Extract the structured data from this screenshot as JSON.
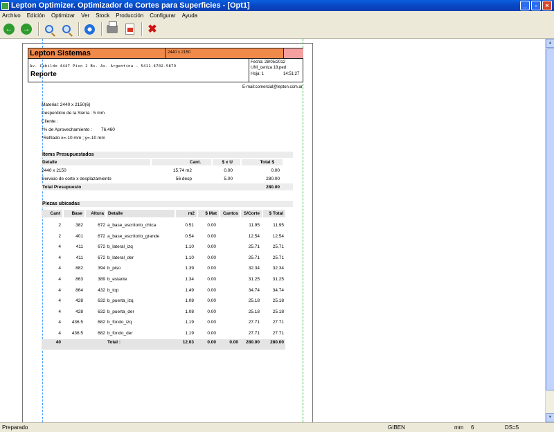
{
  "window": {
    "title": "Lepton Optimizer. Optimizador de Cortes para Superficies - [Opt1]",
    "buttons": [
      "_",
      "▫",
      "×"
    ]
  },
  "menu": [
    "Archivo",
    "Edición",
    "Optimizar",
    "Ver",
    "Stock",
    "Producción",
    "Configurar",
    "Ayuda"
  ],
  "toolbar_icons": [
    "back-arrow-icon",
    "forward-arrow-icon",
    "zoom-in-icon",
    "zoom-out-icon",
    "settings-gear-icon",
    "print-icon",
    "pdf-icon",
    "close-x-icon"
  ],
  "report": {
    "company": "Lepton Sistemas",
    "sheet_size": "2440 x 2150",
    "address": "Av. Cabildo 4447 Piso 2 Bs. As. Argentina - 5411-4702-5879",
    "title": "Reporte",
    "date": "Fecha: 28/05/2012",
    "file": "UNI_ceniza 18.ped",
    "page": "Hoja:   1",
    "time": "14:51:27",
    "email": "E-mail:comercial@lepton.com.ar",
    "material": "Material: 2440 x 2150(6)",
    "saw_waste": "Desperdicio de la Sierra : 5 mm",
    "client": "Cliente :",
    "usage_label": "*% de Aprovechamiento :",
    "usage_value": "76.460",
    "trim": "*Refilado x=-10 mm  ;  y=-10 mm",
    "budget_title": "Items Presupuestados",
    "budget_headers": [
      "Detalle",
      "Cant.",
      "$ x U",
      "Total $"
    ],
    "budget_rows": [
      [
        "2440 x 2150",
        "15.74 m2",
        "0.00",
        "0.00"
      ],
      [
        "Servicio de corte x desplazamiento",
        "56 desp",
        "5.00",
        "280.00"
      ]
    ],
    "budget_total_label": "Total Presupuesto",
    "budget_total_value": "280.00",
    "pieces_title": "Piezas ubicadas",
    "pieces_headers": [
      "Cant",
      "Base",
      "Altura",
      "Detalle",
      "m2",
      "$ Mat",
      "Cantos",
      "S/Corte",
      "$ Total"
    ],
    "pieces": [
      [
        "2",
        "382",
        "672",
        "a_base_escritorio_chica",
        "0.51",
        "0.00",
        "",
        "11.95",
        "11.95"
      ],
      [
        "2",
        "401",
        "672",
        "a_base_escritorio_grande",
        "0.54",
        "0.00",
        "",
        "12.54",
        "12.54"
      ],
      [
        "4",
        "411",
        "672",
        "b_lateral_izq",
        "1.10",
        "0.00",
        "",
        "25.71",
        "25.71"
      ],
      [
        "4",
        "411",
        "672",
        "b_lateral_der",
        "1.10",
        "0.00",
        "",
        "25.71",
        "25.71"
      ],
      [
        "4",
        "882",
        "394",
        "b_piso",
        "1.39",
        "0.00",
        "",
        "32.34",
        "32.34"
      ],
      [
        "4",
        "863",
        "389",
        "b_estante",
        "1.34",
        "0.00",
        "",
        "31.25",
        "31.25"
      ],
      [
        "4",
        "864",
        "432",
        "b_top",
        "1.49",
        "0.00",
        "",
        "34.74",
        "34.74"
      ],
      [
        "4",
        "428",
        "632",
        "b_puerta_izq",
        "1.08",
        "0.00",
        "",
        "25.18",
        "25.18"
      ],
      [
        "4",
        "428",
        "632",
        "b_puerta_der",
        "1.08",
        "0.00",
        "",
        "25.18",
        "25.18"
      ],
      [
        "4",
        "436.5",
        "682",
        "b_fondo_izq",
        "1.19",
        "0.00",
        "",
        "27.71",
        "27.71"
      ],
      [
        "4",
        "436.5",
        "682",
        "b_fondo_der",
        "1.19",
        "0.00",
        "",
        "27.71",
        "27.71"
      ]
    ],
    "pieces_total": [
      "40",
      "",
      "",
      "Total :",
      "12.03",
      "0.00",
      "0.00",
      "280.00",
      "280.00"
    ]
  },
  "status": {
    "state": "Preparado",
    "machine": "GIBEN",
    "unit": "mm",
    "num": "6",
    "ds": "DS=5"
  }
}
